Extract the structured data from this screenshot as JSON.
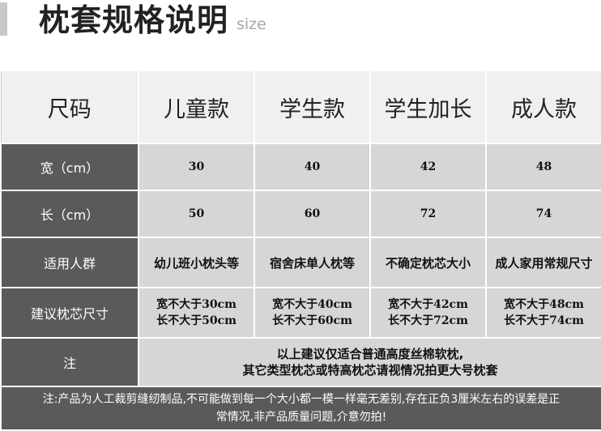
{
  "title": "枕套规格说明",
  "subtitle": "size",
  "columns": [
    "尺码",
    "儿童款",
    "学生款",
    "学生加长",
    "成人款"
  ],
  "rows": {
    "width": {
      "label": "宽（cm）",
      "values": [
        "30",
        "40",
        "42",
        "48"
      ]
    },
    "length": {
      "label": "长（cm）",
      "values": [
        "50",
        "60",
        "72",
        "74"
      ]
    },
    "audience": {
      "label": "适用人群",
      "values": [
        "幼儿班小枕头等",
        "宿舍床单人枕等",
        "不确定枕芯大小",
        "成人家用常规尺寸"
      ]
    },
    "suggest": {
      "label": "建议枕芯尺寸",
      "values": [
        {
          "w": "宽不大于30cm",
          "l": "长不大于50cm"
        },
        {
          "w": "宽不大于40cm",
          "l": "长不大于60cm"
        },
        {
          "w": "宽不大于42cm",
          "l": "长不大于72cm"
        },
        {
          "w": "宽不大于48cm",
          "l": "长不大于74cm"
        }
      ]
    },
    "note": {
      "label": "注",
      "line1": "以上建议仅适合普通高度丝棉软枕,",
      "line2": "其它类型枕芯或特高枕芯请视情况拍更大号枕套"
    }
  },
  "footer": {
    "line1": "注:产品为人工裁剪缝纫制品,不可能做到每一个大小都一模一样毫无差别,存在正负3厘米左右的误差是正",
    "line2": "常情况,非产品质量问题,介意勿拍!"
  }
}
